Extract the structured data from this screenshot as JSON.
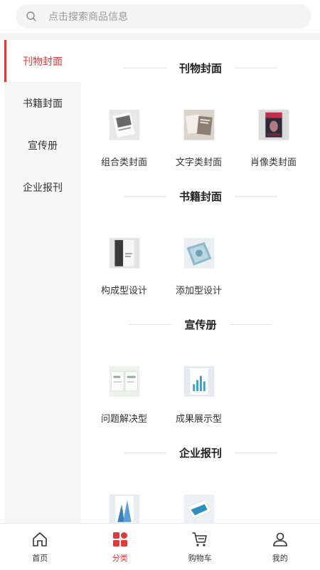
{
  "search": {
    "placeholder": "点击搜索商品信息",
    "icon": "search-icon"
  },
  "sidebar": {
    "items": [
      {
        "label": "刊物封面",
        "active": true
      },
      {
        "label": "书籍封面",
        "active": false
      },
      {
        "label": "宣传册",
        "active": false
      },
      {
        "label": "企业报刊",
        "active": false
      }
    ]
  },
  "sections": [
    {
      "title": "刊物封面",
      "items": [
        {
          "label": "组合类封面"
        },
        {
          "label": "文字类封面"
        },
        {
          "label": "肖像类封面"
        }
      ]
    },
    {
      "title": "书籍封面",
      "items": [
        {
          "label": "构成型设计"
        },
        {
          "label": "添加型设计"
        }
      ]
    },
    {
      "title": "宣传册",
      "items": [
        {
          "label": "问题解决型"
        },
        {
          "label": "成果展示型"
        }
      ]
    },
    {
      "title": "企业报刊",
      "items": [
        {
          "label": ""
        },
        {
          "label": ""
        }
      ]
    }
  ],
  "tabbar": {
    "items": [
      {
        "label": "首页",
        "icon": "home-icon"
      },
      {
        "label": "分类",
        "icon": "category-icon",
        "active": true
      },
      {
        "label": "购物车",
        "icon": "cart-icon"
      },
      {
        "label": "我的",
        "icon": "user-icon"
      }
    ]
  },
  "colors": {
    "accent": "#e03a3a",
    "sidebar_bg": "#f6f6f6",
    "search_bg": "#f4f4f4"
  }
}
